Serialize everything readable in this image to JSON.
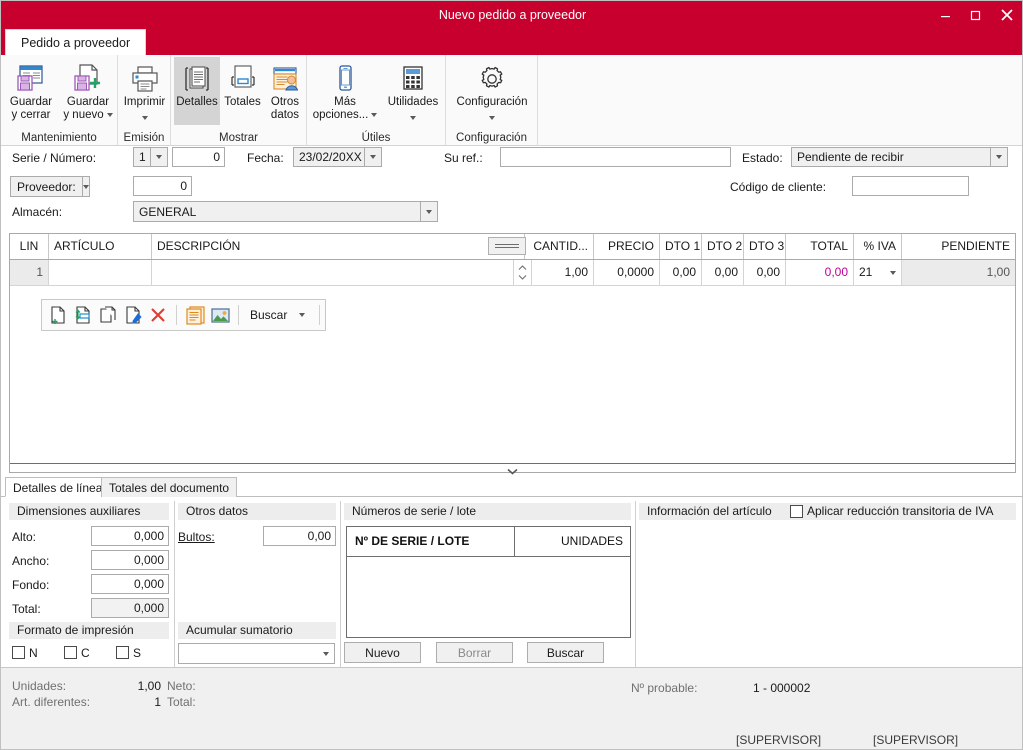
{
  "window": {
    "title": "Nuevo pedido a proveedor",
    "minimize": "minimize-icon",
    "maximize": "maximize-icon",
    "close": "close-icon",
    "accent_color": "#c8002e"
  },
  "ribbon": {
    "tab_label": "Pedido a proveedor",
    "groups": [
      {
        "label": "Mantenimiento",
        "buttons": [
          {
            "label_line1": "Guardar",
            "label_line2": "y cerrar",
            "icon": "save-close-icon",
            "dropdown": false
          },
          {
            "label_line1": "Guardar",
            "label_line2": "y nuevo",
            "icon": "save-new-icon",
            "dropdown": true
          }
        ]
      },
      {
        "label": "Emisión",
        "buttons": [
          {
            "label_line1": "Imprimir",
            "label_line2": "",
            "icon": "printer-icon",
            "dropdown": true
          }
        ]
      },
      {
        "label": "Mostrar",
        "buttons": [
          {
            "label_line1": "Detalles",
            "label_line2": "",
            "icon": "details-icon",
            "dropdown": false,
            "selected": true
          },
          {
            "label_line1": "Totales",
            "label_line2": "",
            "icon": "totals-icon",
            "dropdown": false
          },
          {
            "label_line1": "Otros",
            "label_line2": "datos",
            "icon": "other-data-icon",
            "dropdown": false
          }
        ]
      },
      {
        "label": "Útiles",
        "buttons": [
          {
            "label_line1": "Más",
            "label_line2": "opciones...",
            "icon": "mobile-icon",
            "dropdown": true
          },
          {
            "label_line1": "Utilidades",
            "label_line2": "",
            "icon": "calculator-icon",
            "dropdown": true
          }
        ]
      },
      {
        "label": "Configuración",
        "buttons": [
          {
            "label_line1": "Configuración",
            "label_line2": "",
            "icon": "gear-icon",
            "dropdown": true
          }
        ]
      }
    ]
  },
  "header_form": {
    "serie_numero_label": "Serie / Número:",
    "serie_value": "1",
    "numero_value": "0",
    "fecha_label": "Fecha:",
    "fecha_value": "23/02/20XX",
    "su_ref_label": "Su ref.:",
    "su_ref_value": "",
    "estado_label": "Estado:",
    "estado_value": "Pendiente de recibir",
    "proveedor_label": "Proveedor:",
    "proveedor_value": "0",
    "codigo_cliente_label": "Código de cliente:",
    "codigo_cliente_value": "",
    "almacen_label": "Almacén:",
    "almacen_value": "GENERAL"
  },
  "grid": {
    "columns": [
      "LIN",
      "ARTÍCULO",
      "DESCRIPCIÓN",
      "CANTID...",
      "PRECIO",
      "DTO 1",
      "DTO 2",
      "DTO 3",
      "TOTAL",
      "% IVA",
      "PENDIENTE"
    ],
    "splitter_icon": "column-splitter-icon",
    "rows": [
      {
        "lin": "1",
        "articulo": "",
        "descripcion": "",
        "cantidad": "1,00",
        "precio": "0,0000",
        "dto1": "0,00",
        "dto2": "0,00",
        "dto3": "0,00",
        "total": "0,00",
        "iva": "21",
        "pendiente": "1,00"
      }
    ],
    "expander_icon": "chevron-down-icon"
  },
  "line_toolbar": {
    "icons": [
      "new-line-icon",
      "insert-line-icon",
      "copy-line-icon",
      "edit-line-icon",
      "delete-line-icon",
      "note-icon",
      "image-icon"
    ],
    "search_label": "Buscar",
    "search_dropdown_icon": "chevron-down-icon"
  },
  "bottom_tabs": [
    {
      "label": "Detalles de línea",
      "active": true
    },
    {
      "label": "Totales del documento",
      "active": false
    }
  ],
  "panels": {
    "dimensiones": {
      "title": "Dimensiones auxiliares",
      "fields": [
        {
          "label": "Alto:",
          "value": "0,000",
          "readonly": false
        },
        {
          "label": "Ancho:",
          "value": "0,000",
          "readonly": false
        },
        {
          "label": "Fondo:",
          "value": "0,000",
          "readonly": false
        },
        {
          "label": "Total:",
          "value": "0,000",
          "readonly": true
        }
      ]
    },
    "formato_impresion": {
      "title": "Formato de impresión",
      "checkboxes": [
        {
          "label": "N",
          "checked": false
        },
        {
          "label": "C",
          "checked": false
        },
        {
          "label": "S",
          "checked": false
        }
      ]
    },
    "otros_datos": {
      "title": "Otros datos",
      "bultos_label": "Bultos:",
      "bultos_value": "0,00"
    },
    "acumular": {
      "title": "Acumular sumatorio",
      "value": ""
    },
    "numeros_serie": {
      "title": "Números de serie / lote",
      "col_serie": "Nº DE SERIE / LOTE",
      "col_unidades": "UNIDADES",
      "rows": [],
      "buttons": [
        {
          "label": "Nuevo",
          "disabled": false
        },
        {
          "label": "Borrar",
          "disabled": true
        },
        {
          "label": "Buscar",
          "disabled": false
        }
      ]
    },
    "info_articulo": {
      "title": "Información del artículo",
      "checkbox_label": "Aplicar reducción transitoria de IVA",
      "checkbox_checked": false
    }
  },
  "status": {
    "unidades_label": "Unidades:",
    "unidades_value": "1,00",
    "art_diferentes_label": "Art. diferentes:",
    "art_diferentes_value": "1",
    "neto_label": "Neto:",
    "neto_value": "",
    "total_label": "Total:",
    "total_value": "",
    "n_probable_label": "Nº probable:",
    "n_probable_value": "1 - 000002",
    "user_left": "[SUPERVISOR]",
    "user_right": "[SUPERVISOR]"
  }
}
